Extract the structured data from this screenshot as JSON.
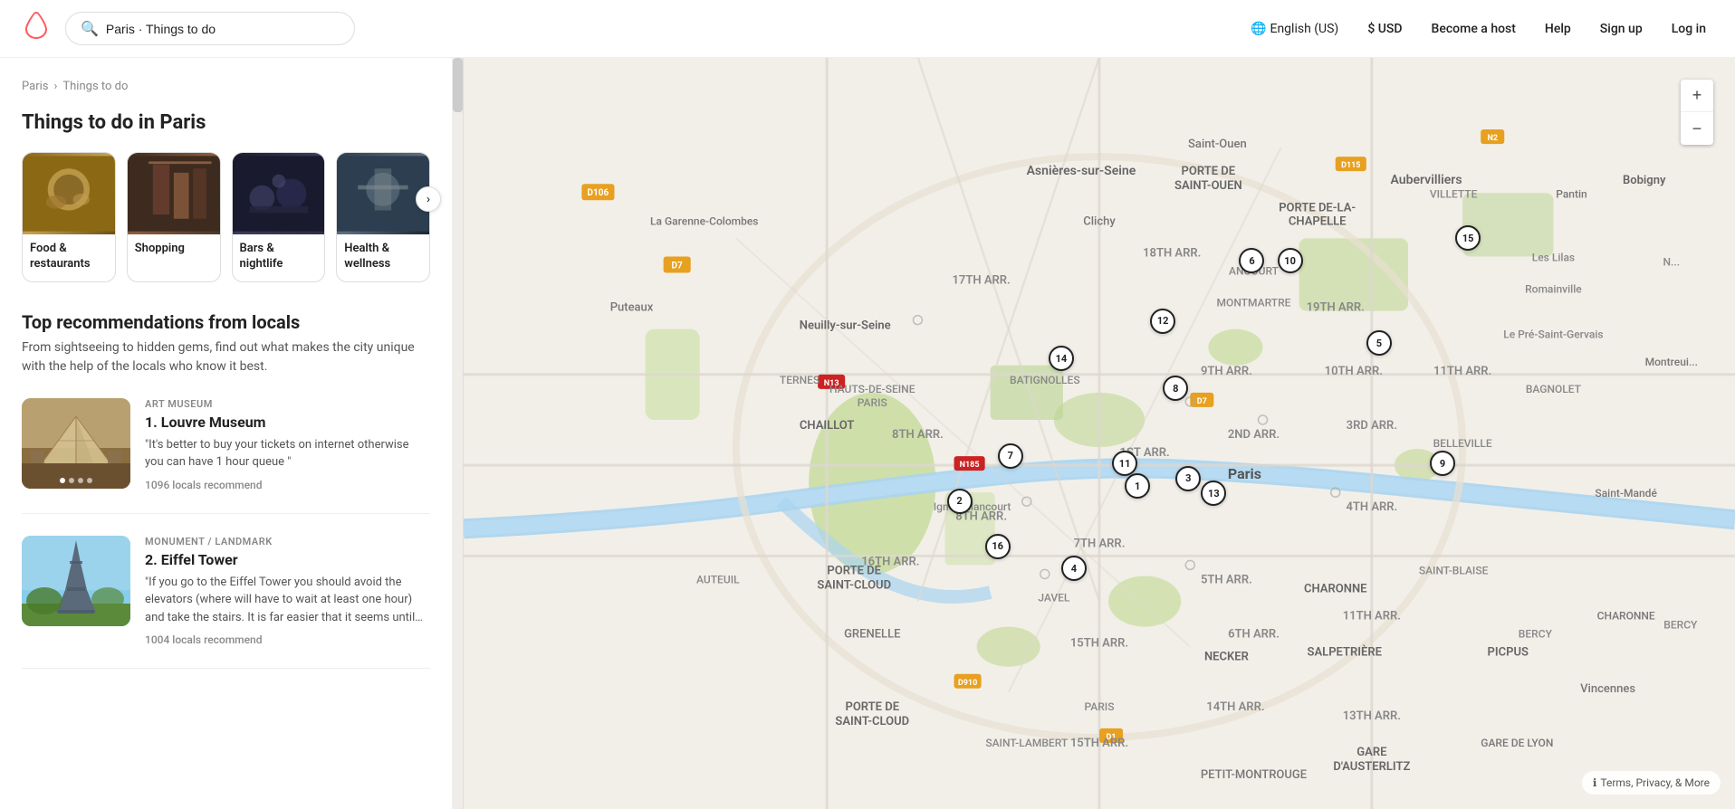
{
  "header": {
    "logo_label": "Airbnb",
    "search_placeholder": "Paris · Things to do",
    "search_value": "Paris · Things to do",
    "lang_label": "English (US)",
    "currency_label": "$ USD",
    "become_host_label": "Become a host",
    "help_label": "Help",
    "signup_label": "Sign up",
    "login_label": "Log in"
  },
  "breadcrumb": {
    "parent": "Paris",
    "separator": "›",
    "current": "Things to do"
  },
  "left": {
    "section_title": "Things to do in Paris",
    "categories": [
      {
        "id": "food",
        "label": "Food &\nrestaurants",
        "color_class": "card-img-food"
      },
      {
        "id": "shopping",
        "label": "Shopping",
        "color_class": "card-img-shopping"
      },
      {
        "id": "bars",
        "label": "Bars &\nnightlife",
        "color_class": "card-img-bars"
      },
      {
        "id": "health",
        "label": "Health &\nwellness",
        "color_class": "card-img-health"
      }
    ],
    "carousel_next": "›",
    "recommendations_title": "Top recommendations from locals",
    "recommendations_desc": "From sightseeing to hidden gems, find out what makes the city unique with the help of the locals who know it best.",
    "recommendations": [
      {
        "id": 1,
        "category": "ART MUSEUM",
        "name": "1. Louvre Museum",
        "quote": "\"It's better to buy your tickets on internet otherwise you can have 1 hour queue \"",
        "locals_count": "1096 locals recommend",
        "img_type": "louvre",
        "dots": [
          true,
          false,
          false,
          false
        ]
      },
      {
        "id": 2,
        "category": "MONUMENT / LANDMARK",
        "name": "2. Eiffel Tower",
        "quote": "\"If you go to the Eiffel Tower you should avoid the elevators (where will have to wait at least one hour) and take the stairs. It is far easier that it seems until the...",
        "locals_count": "1004 locals recommend",
        "img_type": "eiffel",
        "dots": []
      }
    ]
  },
  "map": {
    "markers": [
      {
        "id": "1",
        "x": 53,
        "y": 57
      },
      {
        "id": "2",
        "x": 39,
        "y": 59
      },
      {
        "id": "3",
        "x": 57,
        "y": 56
      },
      {
        "id": "4",
        "x": 48,
        "y": 68
      },
      {
        "id": "5",
        "x": 72,
        "y": 38
      },
      {
        "id": "6",
        "x": 62,
        "y": 27
      },
      {
        "id": "7",
        "x": 43,
        "y": 53
      },
      {
        "id": "8",
        "x": 56,
        "y": 44
      },
      {
        "id": "9",
        "x": 77,
        "y": 54
      },
      {
        "id": "10",
        "x": 65,
        "y": 27
      },
      {
        "id": "11",
        "x": 52,
        "y": 54
      },
      {
        "id": "12",
        "x": 55,
        "y": 35
      },
      {
        "id": "13",
        "x": 59,
        "y": 58
      },
      {
        "id": "14",
        "x": 47,
        "y": 40
      },
      {
        "id": "15",
        "x": 79,
        "y": 24
      },
      {
        "id": "16",
        "x": 42,
        "y": 65
      }
    ],
    "zoom_in": "+",
    "zoom_out": "−",
    "terms_label": "Terms, Privacy, & More",
    "info_icon": "ℹ"
  }
}
